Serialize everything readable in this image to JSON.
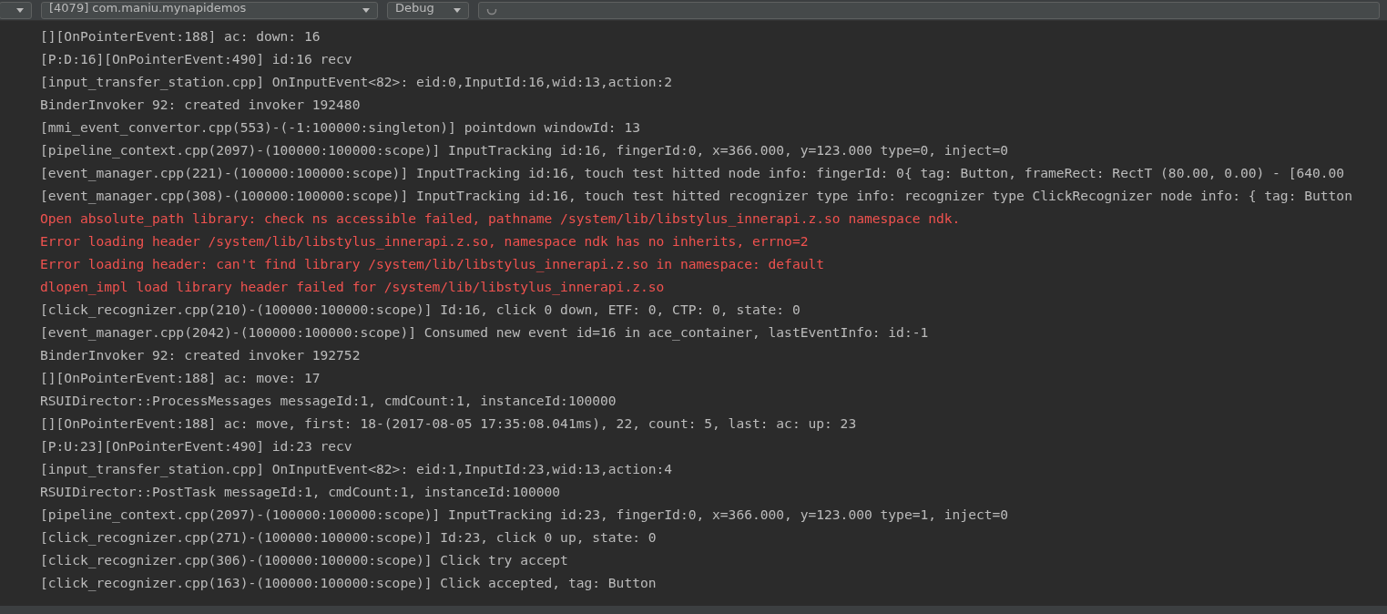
{
  "toolbar": {
    "device_dropdown": "[4079] com.maniu.mynapidemos",
    "level_dropdown": "Debug"
  },
  "log_lines": [
    {
      "kind": "info",
      "text": "[][OnPointerEvent:188] ac: down: 16"
    },
    {
      "kind": "info",
      "text": "[P:D:16][OnPointerEvent:490] id:16 recv"
    },
    {
      "kind": "info",
      "text": "[input_transfer_station.cpp] OnInputEvent<82>: eid:0,InputId:16,wid:13,action:2"
    },
    {
      "kind": "info",
      "text": "BinderInvoker 92: created invoker 192480"
    },
    {
      "kind": "info",
      "text": "[mmi_event_convertor.cpp(553)-(-1:100000:singleton)] pointdown windowId: 13"
    },
    {
      "kind": "info",
      "text": "[pipeline_context.cpp(2097)-(100000:100000:scope)] InputTracking id:16, fingerId:0, x=366.000, y=123.000 type=0, inject=0"
    },
    {
      "kind": "info",
      "text": "[event_manager.cpp(221)-(100000:100000:scope)] InputTracking id:16, touch test hitted node info: fingerId: 0{ tag: Button, frameRect: RectT (80.00, 0.00) - [640.00"
    },
    {
      "kind": "info",
      "text": "[event_manager.cpp(308)-(100000:100000:scope)] InputTracking id:16, touch test hitted recognizer type info: recognizer type ClickRecognizer node info: { tag: Button"
    },
    {
      "kind": "error",
      "text": "Open absolute_path library: check ns accessible failed, pathname /system/lib/libstylus_innerapi.z.so namespace ndk."
    },
    {
      "kind": "error",
      "text": "Error loading header /system/lib/libstylus_innerapi.z.so, namespace ndk has no inherits, errno=2"
    },
    {
      "kind": "error",
      "text": "Error loading header: can't find library /system/lib/libstylus_innerapi.z.so in namespace: default"
    },
    {
      "kind": "error",
      "text": "dlopen_impl load library header failed for /system/lib/libstylus_innerapi.z.so"
    },
    {
      "kind": "info",
      "text": "[click_recognizer.cpp(210)-(100000:100000:scope)] Id:16, click 0 down, ETF: 0, CTP: 0, state: 0"
    },
    {
      "kind": "info",
      "text": "[event_manager.cpp(2042)-(100000:100000:scope)] Consumed new event id=16 in ace_container, lastEventInfo: id:-1"
    },
    {
      "kind": "info",
      "text": "BinderInvoker 92: created invoker 192752"
    },
    {
      "kind": "info",
      "text": "[][OnPointerEvent:188] ac: move: 17"
    },
    {
      "kind": "info",
      "text": "RSUIDirector::ProcessMessages messageId:1, cmdCount:1, instanceId:100000"
    },
    {
      "kind": "info",
      "text": "[][OnPointerEvent:188] ac: move, first: 18-(2017-08-05 17:35:08.041ms), 22, count: 5, last: ac: up: 23"
    },
    {
      "kind": "info",
      "text": "[P:U:23][OnPointerEvent:490] id:23 recv"
    },
    {
      "kind": "info",
      "text": "[input_transfer_station.cpp] OnInputEvent<82>: eid:1,InputId:23,wid:13,action:4"
    },
    {
      "kind": "info",
      "text": "RSUIDirector::PostTask messageId:1, cmdCount:1, instanceId:100000"
    },
    {
      "kind": "info",
      "text": "[pipeline_context.cpp(2097)-(100000:100000:scope)] InputTracking id:23, fingerId:0, x=366.000, y=123.000 type=1, inject=0"
    },
    {
      "kind": "info",
      "text": "[click_recognizer.cpp(271)-(100000:100000:scope)] Id:23, click 0 up, state: 0"
    },
    {
      "kind": "info",
      "text": "[click_recognizer.cpp(306)-(100000:100000:scope)] Click try accept"
    },
    {
      "kind": "info",
      "text": "[click_recognizer.cpp(163)-(100000:100000:scope)] Click accepted, tag: Button"
    }
  ]
}
